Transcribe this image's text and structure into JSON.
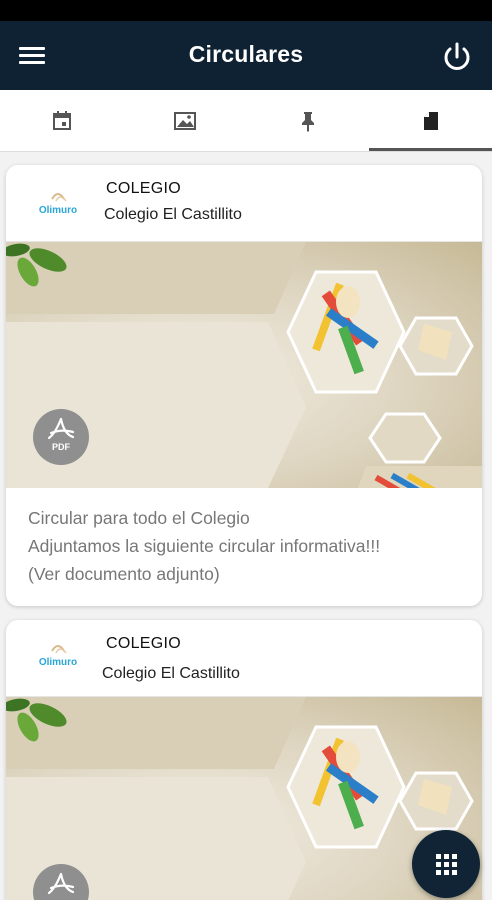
{
  "appbar": {
    "title": "Circulares",
    "menu_icon": "hamburger-menu-icon",
    "power_icon": "power-icon",
    "background": "#0f2233"
  },
  "tabs": [
    {
      "icon": "calendar-icon",
      "selected": false
    },
    {
      "icon": "image-icon",
      "selected": false
    },
    {
      "icon": "pin-icon",
      "selected": false
    },
    {
      "icon": "document-icon",
      "selected": true
    }
  ],
  "cards": [
    {
      "school": "COLEGIO",
      "organization": "Colegio El Castillito",
      "logo_text": "Olimuro",
      "badge": "PDF",
      "title": "Circular para todo el Colegio",
      "message": "Adjuntamos la siguiente circular informativa!!!",
      "note": "(Ver documento adjunto)"
    },
    {
      "school": "COLEGIO",
      "organization": "Colegio El Castillito",
      "logo_text": "Olimuro"
    }
  ],
  "fab": {
    "icon": "apps-grid-icon",
    "background": "#102435"
  }
}
